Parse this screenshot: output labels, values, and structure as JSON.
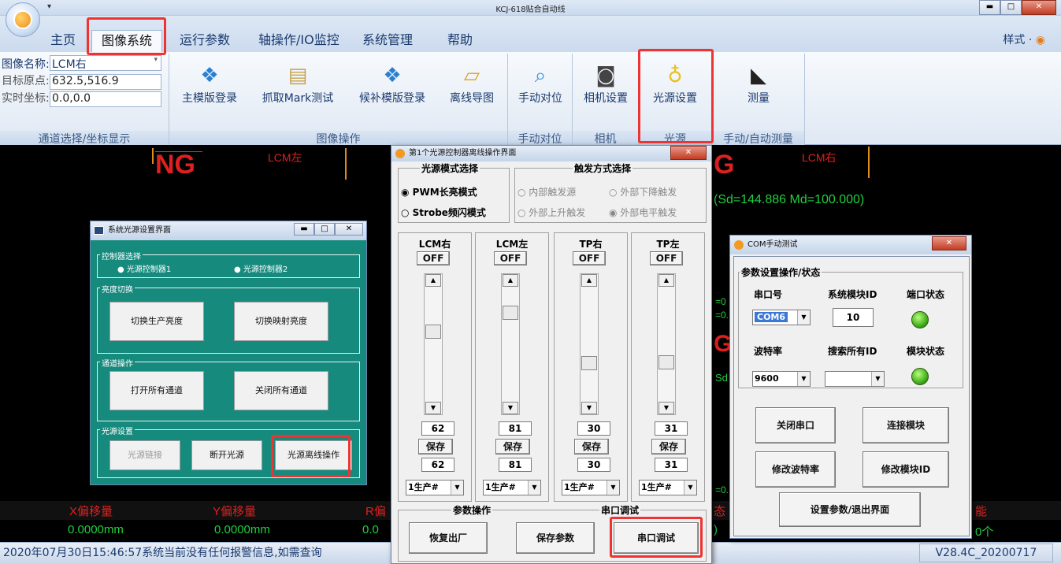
{
  "app": {
    "title": "KCJ-618贴合自动线",
    "qat": "▾"
  },
  "tabs": [
    {
      "label": "主页",
      "active": false
    },
    {
      "label": "图像系统",
      "active": true
    },
    {
      "label": "运行参数",
      "active": false
    },
    {
      "label": "轴操作/IO监控",
      "active": false
    },
    {
      "label": "系统管理",
      "active": false
    },
    {
      "label": "帮助",
      "active": false
    }
  ],
  "style_menu": "样式 ·",
  "ribbon": {
    "fields": [
      {
        "label": "图像名称:",
        "value": "LCM右"
      },
      {
        "label": "目标原点:",
        "value": "632.5,516.9"
      },
      {
        "label": "实时坐标:",
        "value": "0.0,0.0"
      }
    ],
    "buttons": {
      "main_login": "主模版登录",
      "mark_test": "抓取Mark测试",
      "sub_login": "候补模版登录",
      "offline_nav": "离线导图",
      "manual_align": "手动对位",
      "camera_setup": "相机设置",
      "light_setup": "光源设置",
      "measure": "测量"
    },
    "groups": {
      "channel": "通道选择/坐标显示",
      "image_ops": "图像操作",
      "manual_align": "手动对位",
      "camera": "相机",
      "light": "光源",
      "measure": "手动/自动测量"
    }
  },
  "vision": {
    "ng_left": "NG",
    "lcm_left": "LCM左",
    "ng_right": "G",
    "lcm_right": "LCM右",
    "sd_md": "(Sd=144.886 Md=100.000)",
    "x_offset_label": "X偏移量",
    "x_offset_value": "0.0000mm",
    "y_offset_label": "Y偏移量",
    "y_offset_value": "0.0000mm",
    "r_frag": "R偏",
    "r_val_frag": "0.0",
    "right_lbl_frag": "能",
    "right_val_frag": "0个",
    "mid_frag": "态",
    "mid_val_frag": ")"
  },
  "status": {
    "message": "2020年07月30日15:46:57系统当前没有任何报警信息,如需查询",
    "version": "V28.4C_20200717"
  },
  "light_dialog": {
    "title": "系统光源设置界面",
    "controller_legend": "控制器选择",
    "controller1": "光源控制器1",
    "controller2": "光源控制器2",
    "brightness_legend": "亮度切换",
    "btn_prod": "切换生产亮度",
    "btn_map": "切换映射亮度",
    "channel_legend": "通道操作",
    "btn_open_all": "打开所有通道",
    "btn_close_all": "关闭所有通道",
    "setup_legend": "光源设置",
    "btn_link": "光源链接",
    "btn_disconnect": "断开光源",
    "btn_offline": "光源离线操作"
  },
  "offline_dialog": {
    "title": "第1个光源控制器离线操作界面",
    "mode_legend": "光源模式选择",
    "mode_pwm": "PWM长亮模式",
    "mode_strobe": "Strobe频闪模式",
    "trigger_legend": "触发方式选择",
    "trig_internal": "内部触发源",
    "trig_ext_fall": "外部下降触发",
    "trig_ext_rise": "外部上升触发",
    "trig_ext_level": "外部电平触发",
    "channels": [
      {
        "name": "LCM右",
        "toggle": "OFF",
        "value": "62",
        "saved": "62",
        "save": "保存",
        "preset": "1生产#",
        "level": 0.62
      },
      {
        "name": "LCM左",
        "toggle": "OFF",
        "value": "81",
        "saved": "81",
        "save": "保存",
        "preset": "1生产#",
        "level": 0.81
      },
      {
        "name": "TP右",
        "toggle": "OFF",
        "value": "30",
        "saved": "30",
        "save": "保存",
        "preset": "1生产#",
        "level": 0.3
      },
      {
        "name": "TP左",
        "toggle": "OFF",
        "value": "31",
        "saved": "31",
        "save": "保存",
        "preset": "1生产#",
        "level": 0.31
      }
    ],
    "param_legend": "参数操作",
    "serial_legend": "串口调试",
    "btn_restore": "恢复出厂",
    "btn_save_params": "保存参数",
    "btn_serial": "串口调试"
  },
  "com_dialog": {
    "title": "COM手动测试",
    "legend": "参数设置操作/状态",
    "port_label": "串口号",
    "module_id_label": "系统模块ID",
    "port_status_label": "端口状态",
    "port_value": "COM6",
    "module_id_value": "10",
    "baud_label": "波特率",
    "search_label": "搜索所有ID",
    "module_status_label": "模块状态",
    "baud_value": "9600",
    "search_value": "",
    "btn_close_port": "关闭串口",
    "btn_connect": "连接模块",
    "btn_mod_baud": "修改波特率",
    "btn_mod_id": "修改模块ID",
    "btn_exit": "设置参数/退出界面",
    "led_color": "#33a010"
  }
}
